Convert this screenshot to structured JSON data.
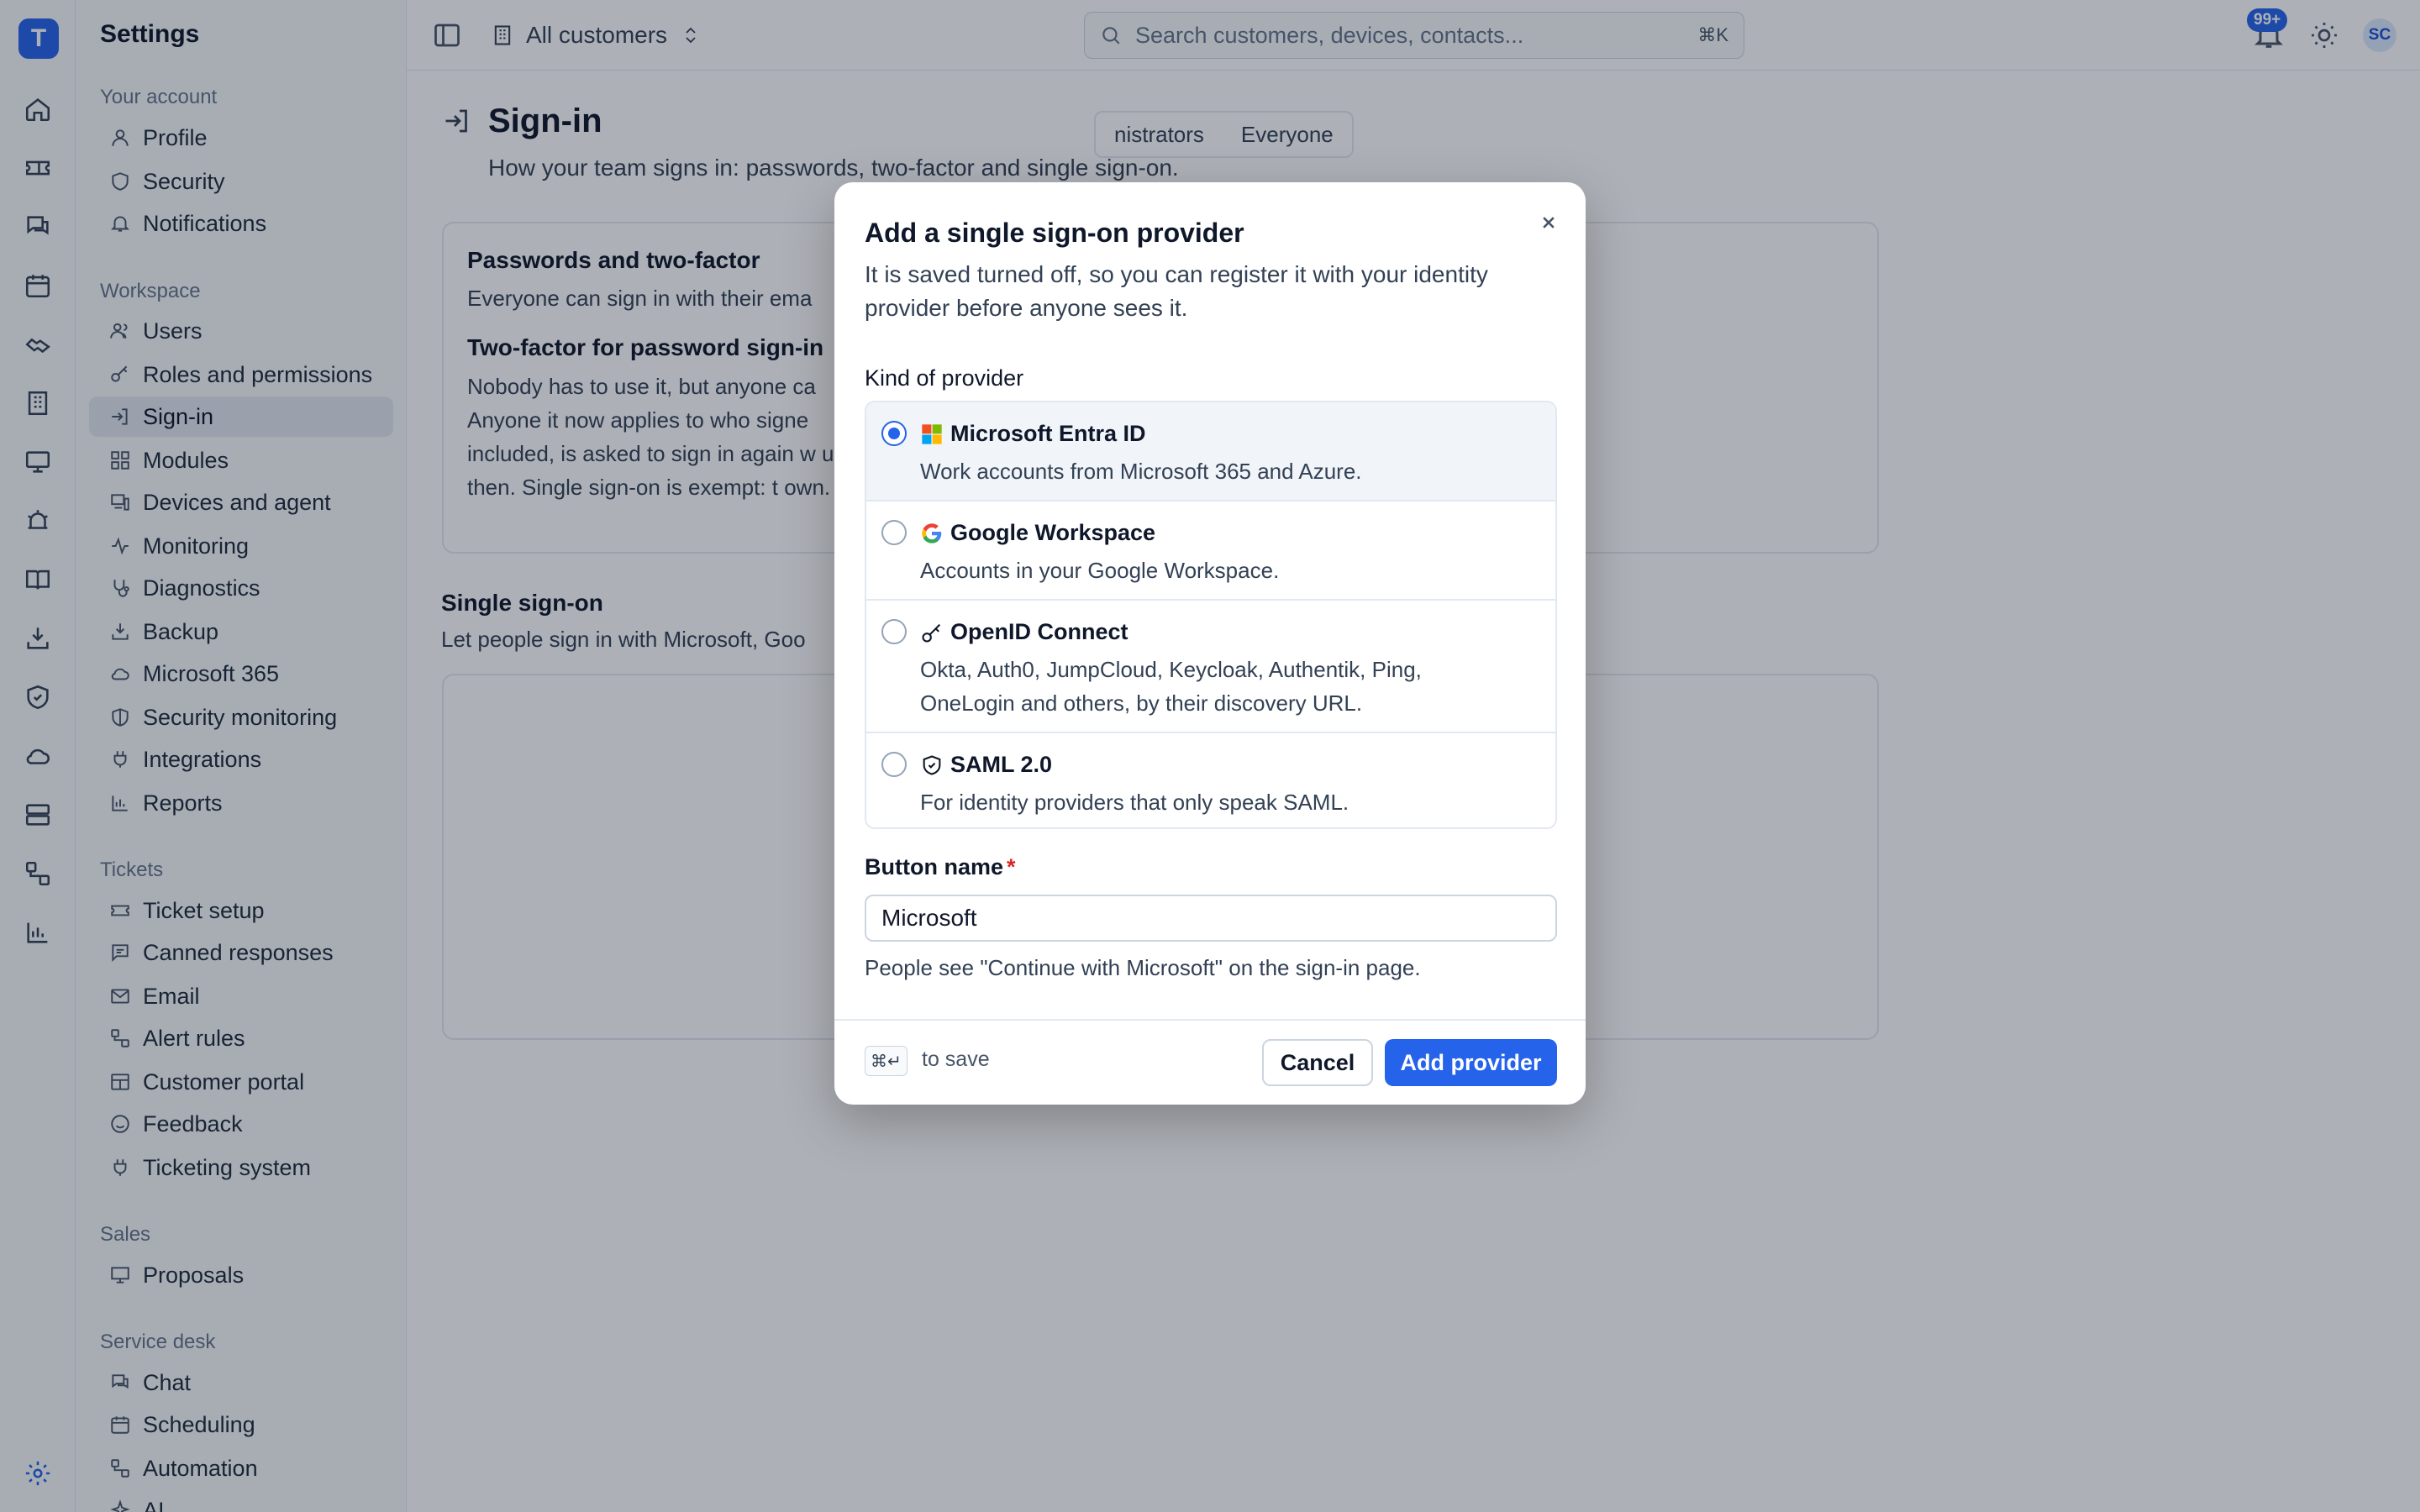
{
  "app": {
    "logo_letter": "T"
  },
  "sidebar": {
    "title": "Settings",
    "sections": [
      {
        "label": "Your account",
        "items": [
          "Profile",
          "Security",
          "Notifications"
        ]
      },
      {
        "label": "Workspace",
        "items": [
          "Users",
          "Roles and permissions",
          "Sign-in",
          "Modules",
          "Devices and agent",
          "Monitoring",
          "Diagnostics",
          "Backup",
          "Microsoft 365",
          "Security monitoring",
          "Integrations",
          "Reports"
        ]
      },
      {
        "label": "Tickets",
        "items": [
          "Ticket setup",
          "Canned responses",
          "Email",
          "Alert rules",
          "Customer portal",
          "Feedback",
          "Ticketing system"
        ]
      },
      {
        "label": "Sales",
        "items": [
          "Proposals"
        ]
      },
      {
        "label": "Service desk",
        "items": [
          "Chat",
          "Scheduling",
          "Automation",
          "AI"
        ]
      }
    ],
    "active_item": "Sign-in"
  },
  "topbar": {
    "customer_switch": "All customers",
    "search_placeholder": "Search customers, devices, contacts...",
    "search_shortcut": "⌘K",
    "notification_count": "99+",
    "avatar_initials": "SC"
  },
  "page": {
    "title": "Sign-in",
    "subtitle": "How your team signs in: passwords, two-factor and single sign-on.",
    "passwords_card": {
      "title": "Passwords and two-factor",
      "description": "Everyone can sign in with their ema",
      "twofactor_title": "Two-factor for password sign-in",
      "twofactor_text": "Nobody has to use it, but anyone ca Anyone it now applies to who signe included, is asked to sign in again w up then. Single sign-on is exempt: t own.",
      "segments": [
        "nistrators",
        "Everyone"
      ]
    },
    "sso": {
      "title": "Single sign-on",
      "description": "Let people sign in with Microsoft, Goo"
    }
  },
  "dialog": {
    "title": "Add a single sign-on provider",
    "lead": "It is saved turned off, so you can register it with your identity provider before anyone sees it.",
    "kind_label": "Kind of provider",
    "options": [
      {
        "name": "Microsoft Entra ID",
        "description": "Work accounts from Microsoft 365 and Azure.",
        "selected": true,
        "icon": "microsoft-logo-icon"
      },
      {
        "name": "Google Workspace",
        "description": "Accounts in your Google Workspace.",
        "selected": false,
        "icon": "google-logo-icon"
      },
      {
        "name": "OpenID Connect",
        "description": "Okta, Auth0, JumpCloud, Keycloak, Authentik, Ping, OneLogin and others, by their discovery URL.",
        "selected": false,
        "icon": "key-icon"
      },
      {
        "name": "SAML 2.0",
        "description": "For identity providers that only speak SAML.",
        "selected": false,
        "icon": "shield-check-icon"
      }
    ],
    "button_name_label": "Button name",
    "required_mark": "*",
    "button_name_value": "Microsoft",
    "button_name_help": "People see \"Continue with Microsoft\" on the sign-in page.",
    "shortcut_key": "⌘↵",
    "shortcut_hint": "to save",
    "cancel_label": "Cancel",
    "submit_label": "Add provider"
  },
  "colors": {
    "accent": "#2563eb",
    "overlay": "rgba(15,23,42,0.34)",
    "required": "#dc2626"
  }
}
